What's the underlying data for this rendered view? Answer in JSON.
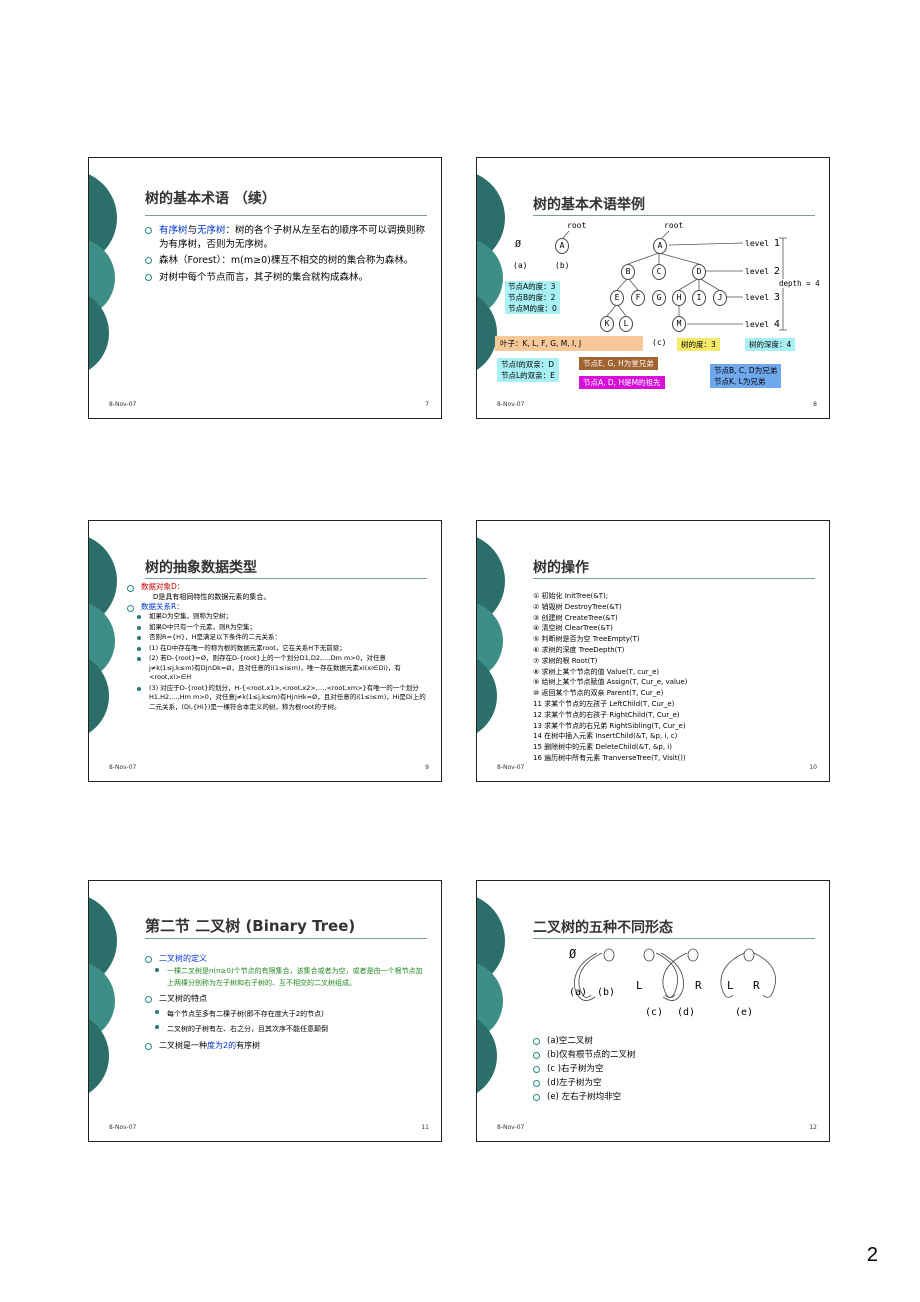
{
  "page_number": "2",
  "date": "8-Nov-07",
  "slide7": {
    "num": "7",
    "title": "树的基本术语 （续）",
    "b1_a": "有序树",
    "b1_b": "与",
    "b1_c": "无序树",
    "b1_d": "：树的各个子树从左至右的顺序不可以调换则称为有序树，否则为无序树。",
    "b2": "森林（Forest）：m(m≥0)棵互不相交的树的集合称为森林。",
    "b3": "对树中每个节点而言，其子树的集合就构成森林。"
  },
  "slide8": {
    "num": "8",
    "title": "树的基本术语举例",
    "root_a": "root",
    "root_b": "root",
    "empty": "Ø",
    "label_a": "(a)",
    "label_b": "(b)",
    "label_c": "(c)",
    "nodes": {
      "A1": "A",
      "A": "A",
      "B": "B",
      "C": "C",
      "D": "D",
      "E": "E",
      "F": "F",
      "G": "G",
      "H": "H",
      "I": "I",
      "J": "J",
      "K": "K",
      "L": "L",
      "M": "M"
    },
    "levels": [
      "level 1",
      "level 2",
      "level 3",
      "level 4"
    ],
    "level_nums": [
      "1",
      "2",
      "3",
      "4"
    ],
    "level_word": "level",
    "depth": "depth = 4",
    "deg": [
      "节点A的度：3",
      "节点B的度：2",
      "节点M的度：0"
    ],
    "leaves": "叶子：K, L, F, G, M, I, J",
    "tree_deg": "树的度：3",
    "tree_depth": "树的深度：4",
    "parent": [
      "节点I的双亲：D",
      "节点L的双亲：E"
    ],
    "siblings1": "节点E, G, H为堂兄弟",
    "ancestor": "节点A, D, H是M的祖先",
    "siblings2": [
      "节点B, C, D为兄弟",
      "节点K, L为兄弟"
    ],
    "colors": {
      "orange": "#f7c99a",
      "cyan": "#a8f0f4",
      "brown": "#a0622e",
      "purple": "#d80fd8",
      "blue": "#6fa8ec",
      "yellow": "#f5ea6a"
    }
  },
  "slide9": {
    "num": "9",
    "title": "树的抽象数据类型",
    "obj_label": "数据对象D：",
    "obj_text": "D是具有相同特性的数据元素的集合。",
    "rel_label": "数据关系R：",
    "items": [
      "如果D为空集，则称为空树；",
      "如果D中只有一个元素，则R为空集；",
      "否则R={H}，H是满足以下条件的二元关系：",
      "(1) 在D中存在唯一的称为根的数据元素root，它在关系H下无前驱；",
      "(2) 若D-{root}=Ø，则存在D-{root}上的一个划分D1,D2,…,Dm m>0，对任意j≠k(1≤j,k≤m)有Dj∩Dk=Ø，且对任意的i(1≤i≤m)，唯一存在数据元素xi(xi∈Di)，有<root,xi>∈H",
      "(3) 对应于D-{root}的划分，H-{<root,x1>,<root,x2>,…,<root,xm>}有唯一的一个划分H1,H2,…,Hm m>0，对任意j≠k(1≤j,k≤m)有Hj∩Hk=Ø，且对任意的i(1≤i≤m)，Hi是Di上的二元关系，(Di,{Hi})是一棵符合本定义的树，称为根root的子树。"
    ]
  },
  "slide10": {
    "num": "10",
    "title": "树的操作",
    "ops": [
      "① 初始化 InitTree(&T);",
      "② 销毁树 DestroyTree(&T)",
      "③ 创建树 CreateTree(&T)",
      "④ 清空树 ClearTree(&T)",
      "⑤ 判断树是否为空 TreeEmpty(T)",
      "⑥ 求树的深度 TreeDepth(T)",
      "⑦ 求树的根 Root(T)",
      "⑧ 求树上某个节点的值 Value(T, cur_e)",
      "⑨ 给树上某个节点赋值 Assign(T, Cur_e, value)",
      "⑩ 返回某个节点的双亲 Parent(T, Cur_e)",
      "11 求某个节点的左孩子 LeftChild(T, Cur_e)",
      "12 求某个节点的右孩子 RightChild(T, Cur_e)",
      "13 求某个节点的右兄弟 RightSibling(T, Cur_e)",
      "14 在树中插入元素 InsertChild(&T, &p, i, c)",
      "15 删除树中的元素 DeleteChild(&T, &p, i)",
      "16 遍历树中所有元素 TranverseTree(T, Visit())"
    ]
  },
  "slide11": {
    "num": "11",
    "title": "第二节 二叉树 (Binary Tree)",
    "def_label": "二叉树的定义",
    "def_text": "一棵二叉树是n(n≥0)个节点的有限集合，该集合或者为空，或者是由一个根节点加上两棵分别称为左子树和右子树的、互不相交的二叉树组成。",
    "feat_label": "二叉树的特点",
    "feat_items": [
      "每个节点至多有二棵子树(即不存在度大于2的节点)",
      "二叉树的子树有左、右之分，且其次序不能任意颠倒"
    ],
    "last_a": "二叉树是一种",
    "last_b": "度为2的",
    "last_c": "有序树"
  },
  "slide12": {
    "num": "12",
    "title": "二叉树的五种不同形态",
    "empty": "Ø",
    "labels": [
      "(a)",
      "(b)",
      "(c)",
      "(d)",
      "(e)"
    ],
    "L": "L",
    "R": "R",
    "items": [
      "(a)空二叉树",
      "(b)仅有根节点的二叉树",
      "(c )右子树为空",
      "(d)左子树为空",
      "(e) 左右子树均非空"
    ]
  }
}
